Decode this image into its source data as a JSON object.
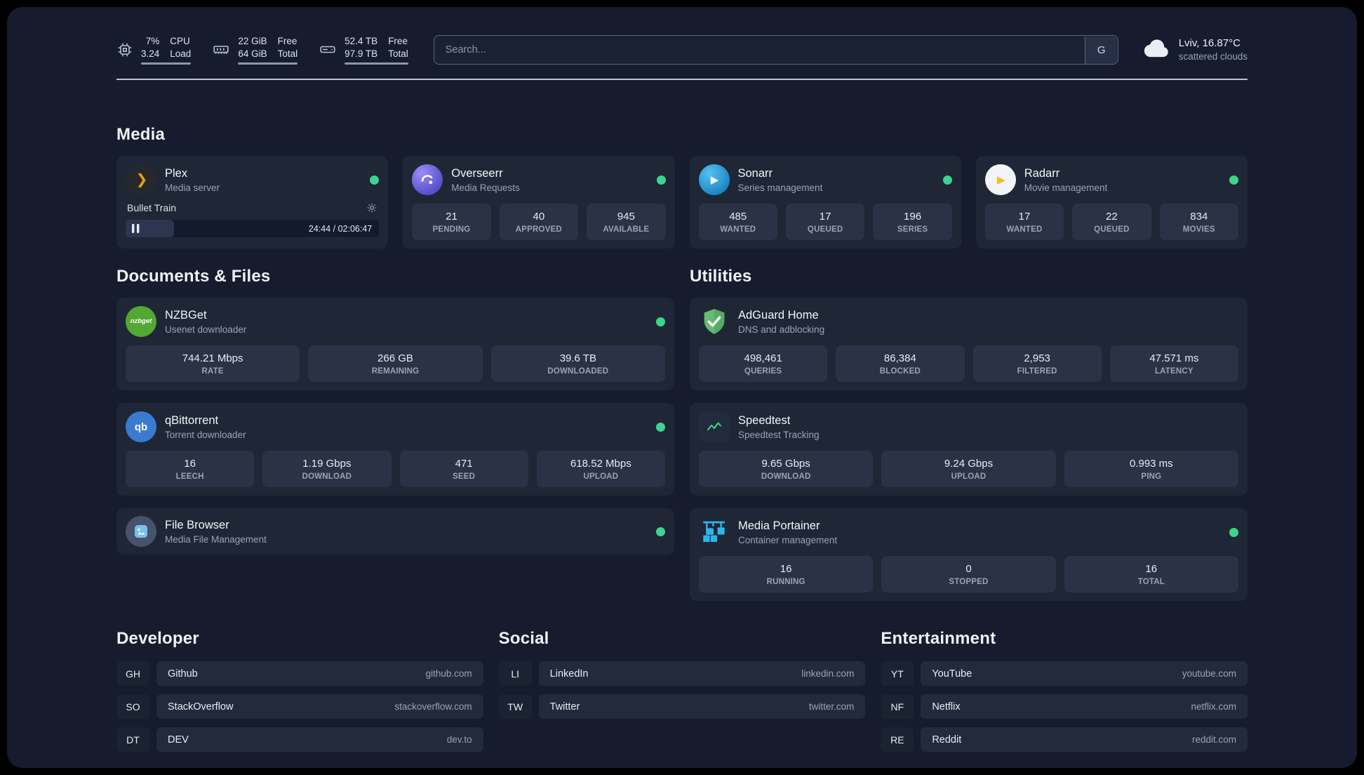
{
  "colors": {
    "background": "#161c2d",
    "card": "#1f2636",
    "stat_tile": "#2b3246",
    "status_online_dot": "#3ed48e",
    "divider": "#bcc2cf",
    "plex_accent": "#e5a00d",
    "speedtest_line": "#3dd68c"
  },
  "topbar": {
    "cpu": {
      "value_1": "7%",
      "value_2": "3.24",
      "label_1": "CPU",
      "label_2": "Load"
    },
    "memory": {
      "value_1": "22 GiB",
      "value_2": "64 GiB",
      "label_1": "Free",
      "label_2": "Total"
    },
    "disk": {
      "value_1": "52.4 TB",
      "value_2": "97.9 TB",
      "label_1": "Free",
      "label_2": "Total"
    },
    "search": {
      "placeholder": "Search...",
      "provider": "G"
    },
    "weather": {
      "location": "Lviv, 16.87°C",
      "condition": "scattered clouds"
    }
  },
  "glyphs": {
    "plex": "❯",
    "sonarr": "▶",
    "radarr": "▶",
    "qbittorrent": "qb",
    "nzbget": "nzbget"
  },
  "sections": {
    "media": {
      "title": "Media",
      "plex": {
        "name": "Plex",
        "desc": "Media server",
        "now_playing": "Bullet Train",
        "time": "24:44 / 02:06:47"
      },
      "overseerr": {
        "name": "Overseerr",
        "desc": "Media Requests",
        "stats": [
          {
            "value": "21",
            "label": "PENDING"
          },
          {
            "value": "40",
            "label": "APPROVED"
          },
          {
            "value": "945",
            "label": "AVAILABLE"
          }
        ]
      },
      "sonarr": {
        "name": "Sonarr",
        "desc": "Series management",
        "stats": [
          {
            "value": "485",
            "label": "WANTED"
          },
          {
            "value": "17",
            "label": "QUEUED"
          },
          {
            "value": "196",
            "label": "SERIES"
          }
        ]
      },
      "radarr": {
        "name": "Radarr",
        "desc": "Movie management",
        "stats": [
          {
            "value": "17",
            "label": "WANTED"
          },
          {
            "value": "22",
            "label": "QUEUED"
          },
          {
            "value": "834",
            "label": "MOVIES"
          }
        ]
      }
    },
    "documents": {
      "title": "Documents & Files",
      "nzbget": {
        "name": "NZBGet",
        "desc": "Usenet downloader",
        "stats": [
          {
            "value": "744.21 Mbps",
            "label": "RATE"
          },
          {
            "value": "266 GB",
            "label": "REMAINING"
          },
          {
            "value": "39.6 TB",
            "label": "DOWNLOADED"
          }
        ]
      },
      "qbittorrent": {
        "name": "qBittorrent",
        "desc": "Torrent downloader",
        "stats": [
          {
            "value": "16",
            "label": "LEECH"
          },
          {
            "value": "1.19 Gbps",
            "label": "DOWNLOAD"
          },
          {
            "value": "471",
            "label": "SEED"
          },
          {
            "value": "618.52 Mbps",
            "label": "UPLOAD"
          }
        ]
      },
      "filebrowser": {
        "name": "File Browser",
        "desc": "Media File Management"
      }
    },
    "utilities": {
      "title": "Utilities",
      "adguard": {
        "name": "AdGuard Home",
        "desc": "DNS and adblocking",
        "stats": [
          {
            "value": "498,461",
            "label": "QUERIES"
          },
          {
            "value": "86,384",
            "label": "BLOCKED"
          },
          {
            "value": "2,953",
            "label": "FILTERED"
          },
          {
            "value": "47.571 ms",
            "label": "LATENCY"
          }
        ]
      },
      "speedtest": {
        "name": "Speedtest",
        "desc": "Speedtest Tracking",
        "stats": [
          {
            "value": "9.65 Gbps",
            "label": "DOWNLOAD"
          },
          {
            "value": "9.24 Gbps",
            "label": "UPLOAD"
          },
          {
            "value": "0.993 ms",
            "label": "PING"
          }
        ]
      },
      "portainer": {
        "name": "Media Portainer",
        "desc": "Container management",
        "stats": [
          {
            "value": "16",
            "label": "RUNNING"
          },
          {
            "value": "0",
            "label": "STOPPED"
          },
          {
            "value": "16",
            "label": "TOTAL"
          }
        ]
      }
    }
  },
  "bookmarks": {
    "developer": {
      "title": "Developer",
      "items": [
        {
          "abbr": "GH",
          "name": "Github",
          "url": "github.com"
        },
        {
          "abbr": "SO",
          "name": "StackOverflow",
          "url": "stackoverflow.com"
        },
        {
          "abbr": "DT",
          "name": "DEV",
          "url": "dev.to"
        }
      ]
    },
    "social": {
      "title": "Social",
      "items": [
        {
          "abbr": "LI",
          "name": "LinkedIn",
          "url": "linkedin.com"
        },
        {
          "abbr": "TW",
          "name": "Twitter",
          "url": "twitter.com"
        }
      ]
    },
    "entertainment": {
      "title": "Entertainment",
      "items": [
        {
          "abbr": "YT",
          "name": "YouTube",
          "url": "youtube.com"
        },
        {
          "abbr": "NF",
          "name": "Netflix",
          "url": "netflix.com"
        },
        {
          "abbr": "RE",
          "name": "Reddit",
          "url": "reddit.com"
        }
      ]
    }
  }
}
